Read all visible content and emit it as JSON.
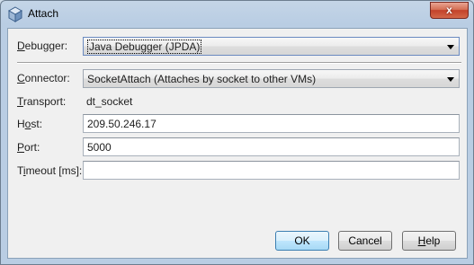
{
  "window": {
    "title": "Attach",
    "close_glyph": "x",
    "icon": "netbeans-cube-icon"
  },
  "form": {
    "debugger": {
      "label_mnemonic": "D",
      "label_rest": "ebugger:",
      "value": "Java Debugger (JPDA)"
    },
    "connector": {
      "label_mnemonic": "C",
      "label_rest": "onnector:",
      "value": "SocketAttach (Attaches by socket to other VMs)"
    },
    "transport": {
      "label_mnemonic": "T",
      "label_rest": "ransport:",
      "value": "dt_socket"
    },
    "host": {
      "label_pre": "H",
      "label_mnemonic": "o",
      "label_rest": "st:",
      "value": "209.50.246.17"
    },
    "port": {
      "label_mnemonic": "P",
      "label_rest": "ort:",
      "value": "5000"
    },
    "timeout": {
      "label_pre": "T",
      "label_mnemonic": "i",
      "label_rest": "meout [ms]:",
      "value": ""
    }
  },
  "buttons": {
    "ok": "OK",
    "cancel": "Cancel",
    "help_mnemonic": "H",
    "help_rest": "elp"
  },
  "colors": {
    "title_frame": "#b9cde3",
    "close_button": "#c3422a",
    "default_button": "#bee6fd",
    "dialog_bg": "#f0f0f0"
  }
}
